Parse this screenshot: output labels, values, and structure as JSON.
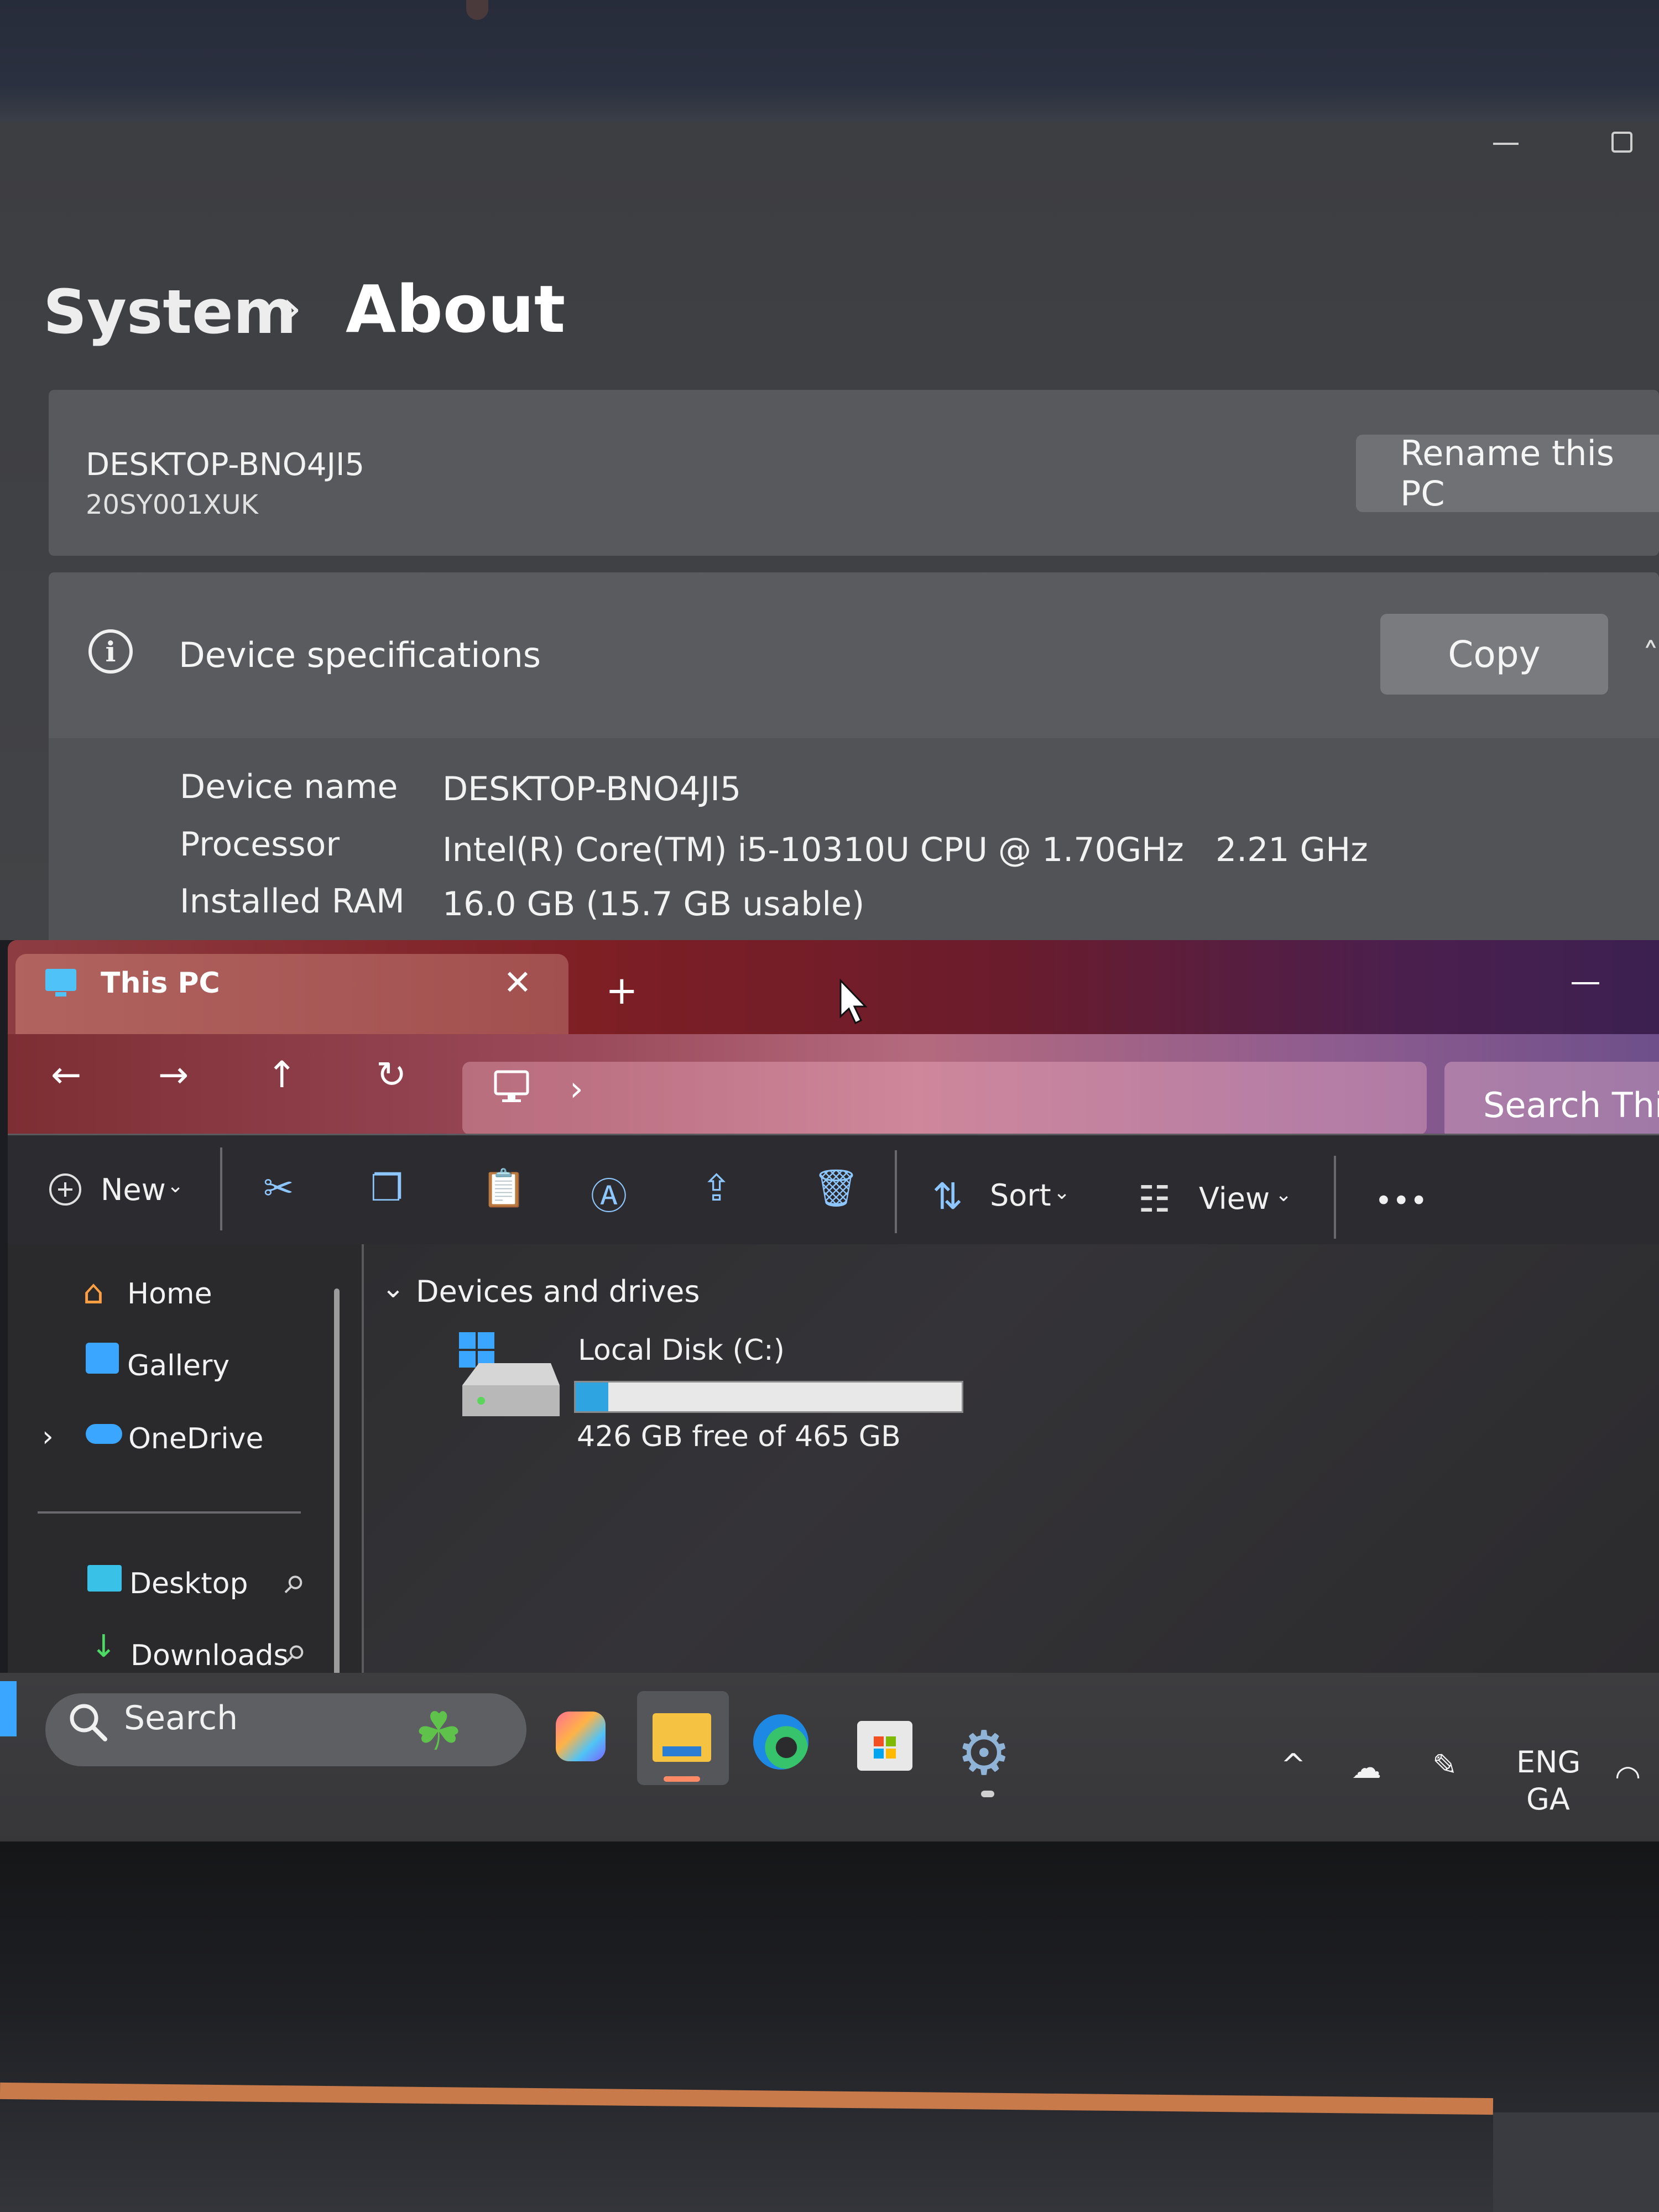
{
  "settings": {
    "breadcrumb": {
      "parent": "System",
      "separator": "›",
      "current": "About"
    },
    "pc_card": {
      "name": "DESKTOP-BNO4JI5",
      "model": "20SY001XUK",
      "rename_label": "Rename this PC"
    },
    "specs": {
      "title": "Device specifications",
      "copy_label": "Copy",
      "rows": [
        {
          "label": "Device name",
          "value": "DESKTOP-BNO4JI5"
        },
        {
          "label": "Processor",
          "value": "Intel(R) Core(TM) i5-10310U CPU @ 1.70GHz   2.21 GHz"
        },
        {
          "label": "Installed RAM",
          "value": "16.0 GB (15.7 GB usable)"
        }
      ]
    }
  },
  "explorer": {
    "tab_title": "This PC",
    "tab_close": "✕",
    "tab_add": "+",
    "nav": {
      "back": "←",
      "forward": "→",
      "up": "↑",
      "refresh": "↻"
    },
    "address_chevron": "›",
    "search_placeholder": "Search This",
    "toolbar": {
      "new_label": "New",
      "sort_label": "Sort",
      "view_label": "View",
      "more": "•••"
    },
    "nav_pane": [
      {
        "label": "Home",
        "icon": "home-icon"
      },
      {
        "label": "Gallery",
        "icon": "gallery-icon"
      },
      {
        "label": "OneDrive",
        "icon": "cloud-icon"
      },
      {
        "label": "Desktop",
        "icon": "desktop-icon"
      },
      {
        "label": "Downloads",
        "icon": "download-icon"
      }
    ],
    "section_title": "Devices and drives",
    "drive": {
      "name": "Local Disk (C:)",
      "free_text": "426 GB free of 465 GB",
      "used_fraction": 0.084
    }
  },
  "taskbar": {
    "search_label": "Search",
    "language": {
      "line1": "ENG",
      "line2": "GA"
    },
    "apps": [
      "copilot-icon",
      "file-explorer-icon",
      "edge-icon",
      "store-icon",
      "settings-icon"
    ]
  },
  "colors": {
    "accent": "#2ea4e0",
    "titlebar_red": "#7e1f24",
    "titlebar_purple": "#4a1f4e"
  }
}
